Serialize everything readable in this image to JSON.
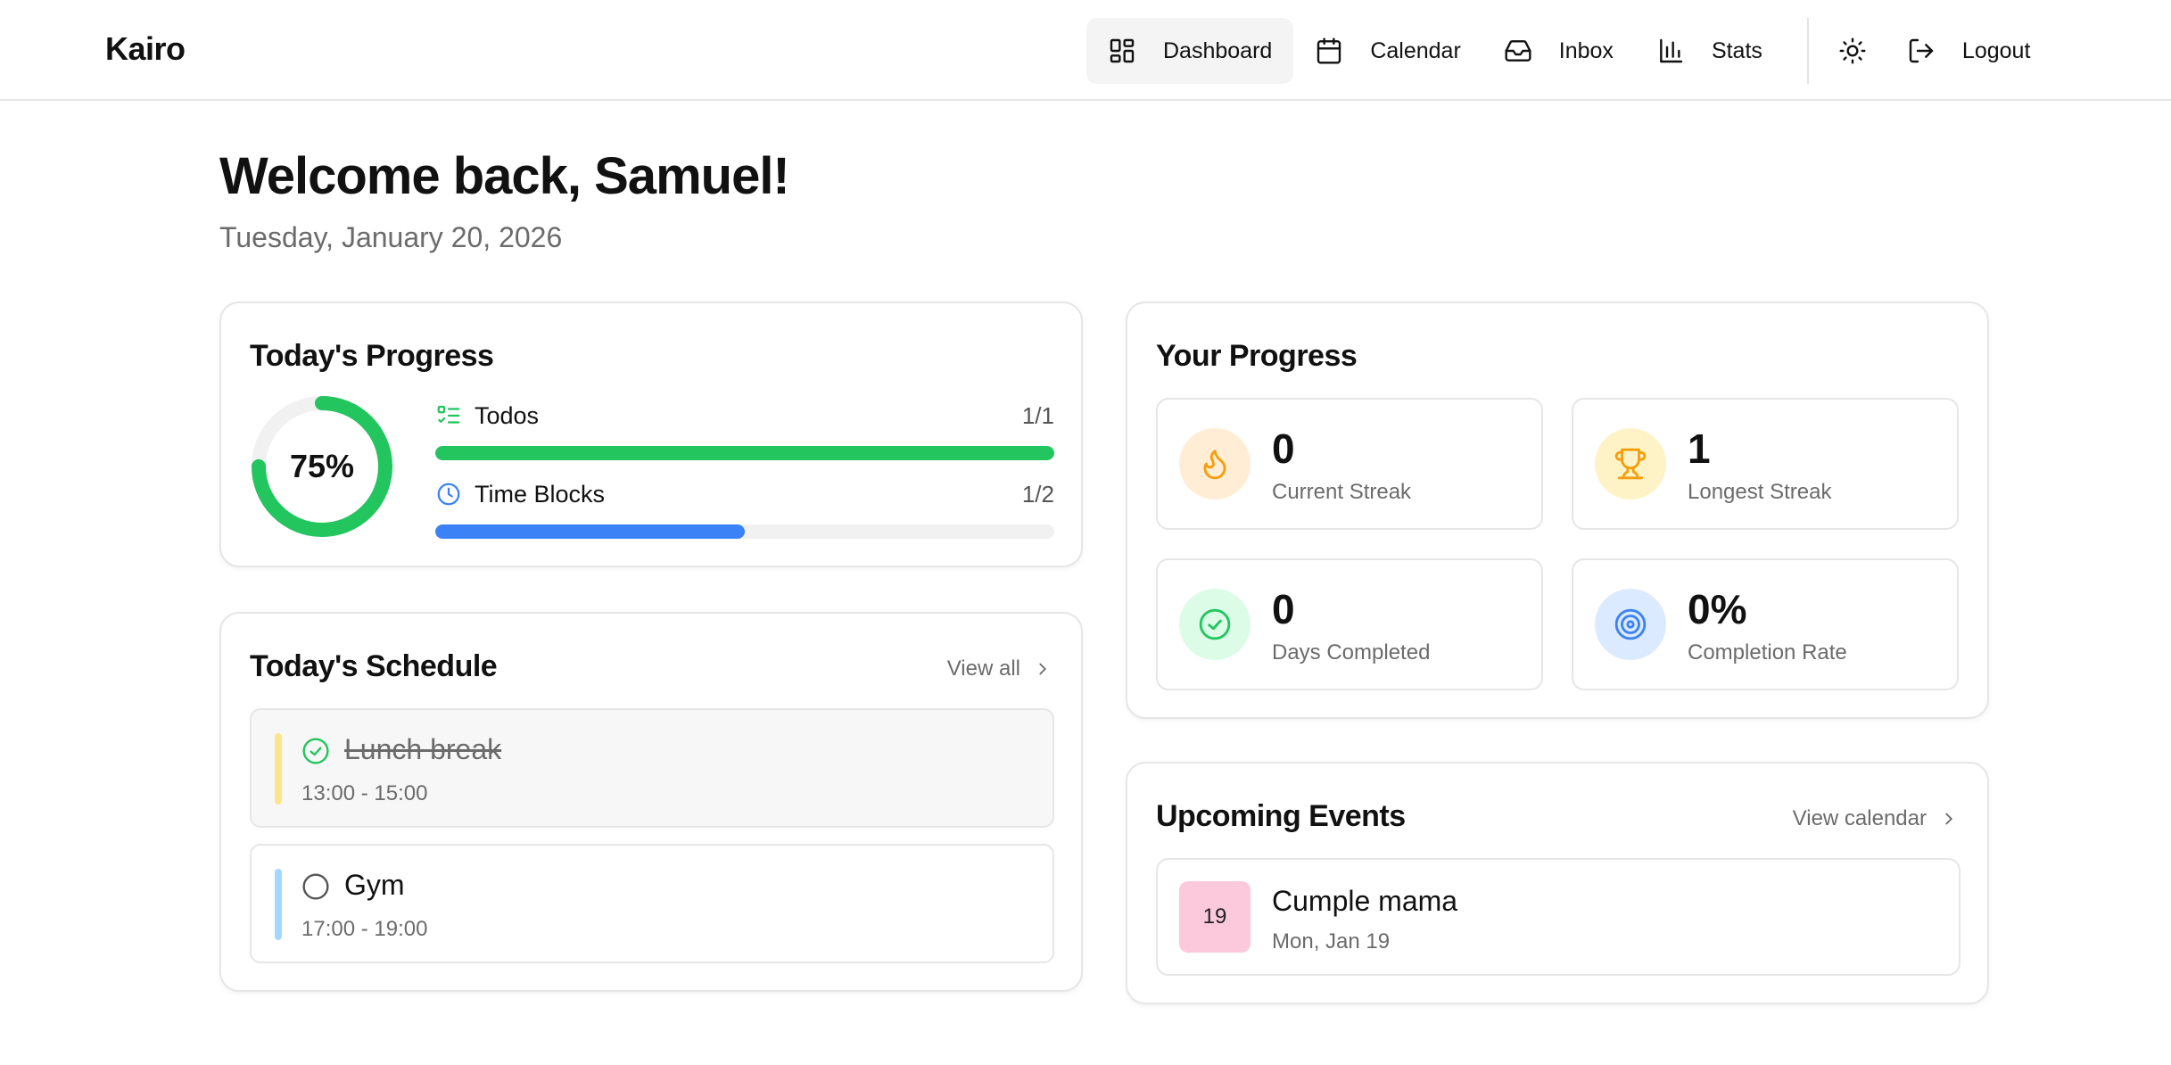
{
  "app": {
    "brand": "Kairo"
  },
  "nav": {
    "dashboard": "Dashboard",
    "calendar": "Calendar",
    "inbox": "Inbox",
    "stats": "Stats",
    "logout": "Logout",
    "active": "Dashboard"
  },
  "welcome": {
    "title": "Welcome back, Samuel!",
    "date": "Tuesday, January 20, 2026"
  },
  "todays_progress": {
    "title": "Today's Progress",
    "percent_label": "75%",
    "percent": 0.75,
    "todos": {
      "label": "Todos",
      "count": "1/1",
      "fraction": 1.0,
      "color": "#22c55e"
    },
    "time_blocks": {
      "label": "Time Blocks",
      "count": "1/2",
      "fraction": 0.5,
      "color": "#3b82f6"
    }
  },
  "schedule": {
    "title": "Today's Schedule",
    "view_all": "View all",
    "items": [
      {
        "name": "Lunch break",
        "time": "13:00 - 15:00",
        "done": true,
        "color": "#fde68a"
      },
      {
        "name": "Gym",
        "time": "17:00 - 19:00",
        "done": false,
        "color": "#a5d8ff"
      }
    ]
  },
  "your_progress": {
    "title": "Your Progress",
    "stats": [
      {
        "value": "0",
        "label": "Current Streak",
        "icon": "flame-icon",
        "bg": "#ffedd5",
        "fg": "#f59e0b"
      },
      {
        "value": "1",
        "label": "Longest Streak",
        "icon": "trophy-icon",
        "bg": "#fef3c7",
        "fg": "#f59e0b"
      },
      {
        "value": "0",
        "label": "Days Completed",
        "icon": "check-circle-icon",
        "bg": "#dcfce7",
        "fg": "#22c55e"
      },
      {
        "value": "0%",
        "label": "Completion Rate",
        "icon": "target-icon",
        "bg": "#dbeafe",
        "fg": "#3b82f6"
      }
    ]
  },
  "events": {
    "title": "Upcoming Events",
    "view_calendar": "View calendar",
    "items": [
      {
        "day": "19",
        "name": "Cumple mama",
        "date": "Mon, Jan 19",
        "color": "#fbc8dc"
      }
    ]
  }
}
